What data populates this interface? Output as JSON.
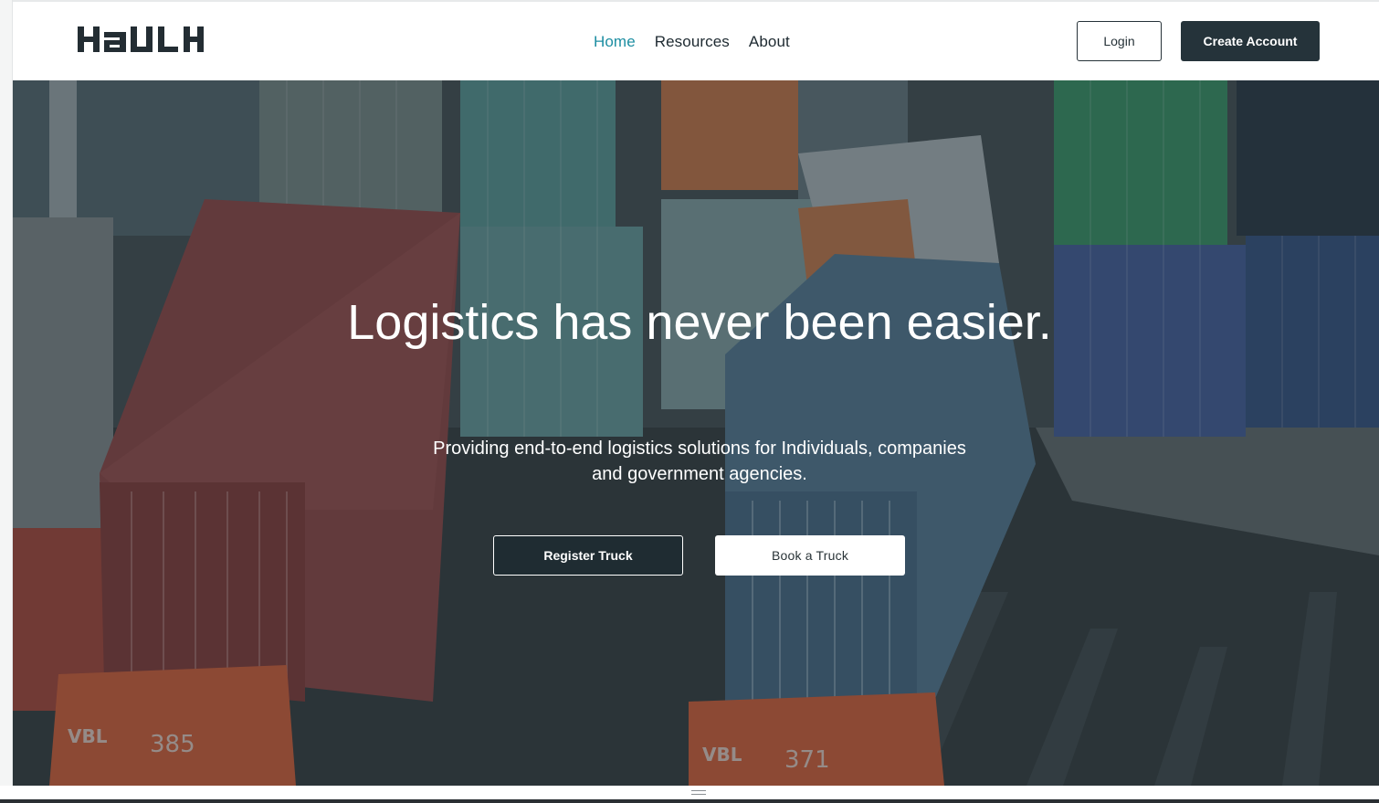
{
  "brand": {
    "logo_text": "HAULK"
  },
  "nav": {
    "items": [
      {
        "label": "Home",
        "active": true
      },
      {
        "label": "Resources",
        "active": false
      },
      {
        "label": "About",
        "active": false
      }
    ]
  },
  "auth": {
    "login_label": "Login",
    "create_label": "Create Account"
  },
  "hero": {
    "title": "Logistics has never been easier.",
    "subtitle": "Providing end-to-end logistics solutions for Individuals, companies and government agencies.",
    "register_label": "Register Truck",
    "book_label": "Book a Truck",
    "background_image": "aerial view of shipping containers on trucks at a port"
  },
  "colors": {
    "accent": "#1d8ea2",
    "dark": "#25333a",
    "text": "#1e2a31",
    "white": "#ffffff"
  }
}
